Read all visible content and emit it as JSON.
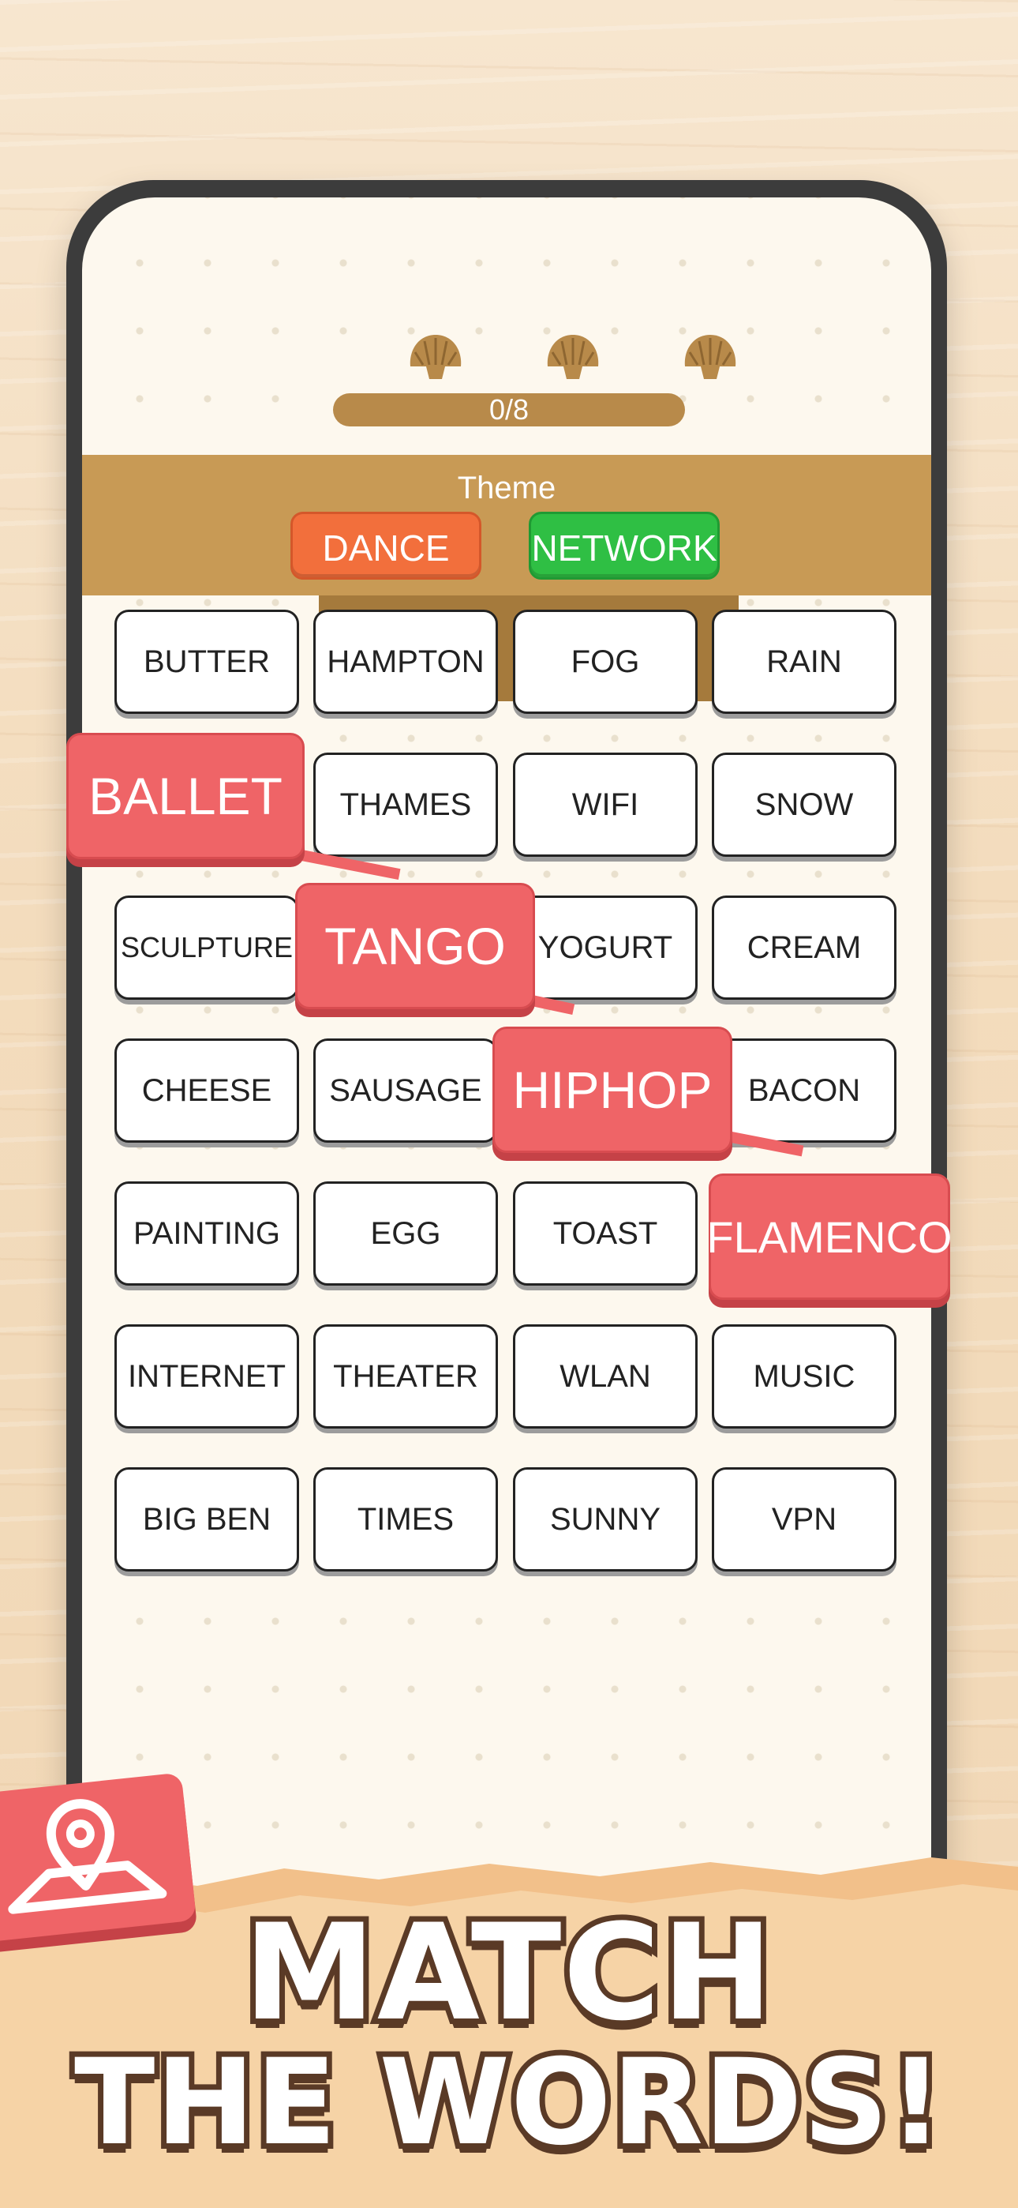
{
  "progress": {
    "text": "0/8",
    "value": 0,
    "max": 8
  },
  "theme": {
    "label": "Theme",
    "chips": [
      "DANCE",
      "NETWORK"
    ]
  },
  "board": {
    "tiles": [
      "BUTTER",
      "HAMPTON",
      "FOG",
      "RAIN",
      "THAMES",
      "WIFI",
      "SNOW",
      "SCULPTURE",
      "YOGURT",
      "CREAM",
      "CHEESE",
      "SAUSAGE",
      "BACON",
      "PAINTING",
      "EGG",
      "TOAST",
      "INTERNET",
      "THEATER",
      "WLAN",
      "MUSIC",
      "BIG BEN",
      "TIMES",
      "SUNNY",
      "VPN"
    ],
    "selected": [
      "BALLET",
      "TANGO",
      "HIPHOP",
      "FLAMENCO"
    ]
  },
  "headline": {
    "line1": "MATCH",
    "line2": "THE WORDS!"
  },
  "colors": {
    "selected": "#ef6467",
    "dance_chip": "#f26f3c",
    "network_chip": "#2fbf44",
    "theme_bar": "#c89a55",
    "text_outline": "#5a3a26"
  },
  "icons": [
    "shell-icon",
    "location-pin-map-icon"
  ]
}
